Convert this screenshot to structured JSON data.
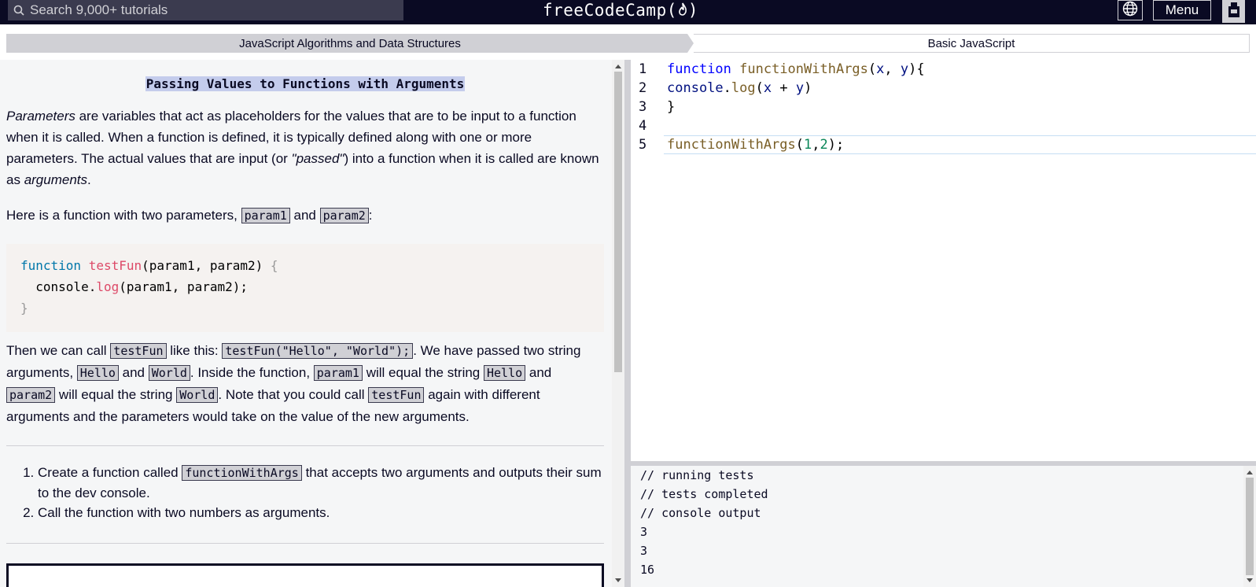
{
  "nav": {
    "search_placeholder": "Search 9,000+ tutorials",
    "brand": "freeCodeCamp(🔥)",
    "brand_text": "freeCodeCamp(",
    "brand_close": ")",
    "menu_label": "Menu",
    "globe_icon": "globe-icon",
    "avatar_icon": "avatar-icon"
  },
  "breadcrumb": {
    "superblock": "JavaScript Algorithms and Data Structures",
    "block": "Basic JavaScript"
  },
  "lesson": {
    "title": "Passing Values to Functions with Arguments",
    "p1_em1": "Parameters",
    "p1_a": " are variables that act as placeholders for the values that are to be input to a function when it is called. When a function is defined, it is typically defined along with one or more parameters. The actual values that are input (or ",
    "p1_em2": "\"passed\"",
    "p1_b": ") into a function when it is called are known as ",
    "p1_em3": "arguments",
    "p1_c": ".",
    "p2_a": "Here is a function with two parameters, ",
    "p2_code1": "param1",
    "p2_b": " and ",
    "p2_code2": "param2",
    "p2_c": ":",
    "code": {
      "l1_kw": "function",
      "l1_fn": "testFun",
      "l1_rest": "(param1, param2) ",
      "l1_brace": "{",
      "l2_a": "  console.",
      "l2_fn": "log",
      "l2_b": "(param1, param2);",
      "l3": "}"
    },
    "p3_a": "Then we can call ",
    "p3_c1": "testFun",
    "p3_b": " like this: ",
    "p3_c2": "testFun(\"Hello\", \"World\");",
    "p3_c": ". We have passed two string arguments, ",
    "p3_c3": "Hello",
    "p3_d": " and ",
    "p3_c4": "World",
    "p3_e": ". Inside the function, ",
    "p3_c5": "param1",
    "p3_f": " will equal the string ",
    "p3_c6": "Hello",
    "p3_g": " and ",
    "p3_c7": "param2",
    "p3_h": " will equal the string ",
    "p3_c8": "World",
    "p3_i": ". Note that you could call ",
    "p3_c9": "testFun",
    "p3_j": " again with different arguments and the parameters would take on the value of the new arguments.",
    "instructions": {
      "i1_a": "Create a function called ",
      "i1_code": "functionWithArgs",
      "i1_b": " that accepts two arguments and outputs their sum to the dev console.",
      "i2": "Call the function with two numbers as arguments."
    }
  },
  "editor": {
    "lines": [
      {
        "num": "1"
      },
      {
        "num": "2"
      },
      {
        "num": "3"
      },
      {
        "num": "4"
      },
      {
        "num": "5"
      }
    ],
    "l1_kw": "function",
    "l1_fn": "functionWithArgs",
    "l1_p1": "(",
    "l1_x": "x",
    "l1_comma": ", ",
    "l1_y": "y",
    "l1_p2": "){",
    "l2_a": "console",
    "l2_b": ".",
    "l2_fn": "log",
    "l2_c": "(",
    "l2_x": "x",
    "l2_op": " + ",
    "l2_y": "y",
    "l2_d": ")",
    "l3": "}",
    "l5_fn": "functionWithArgs",
    "l5_a": "(",
    "l5_n1": "1",
    "l5_comma": ",",
    "l5_n2": "2",
    "l5_b": ");"
  },
  "console": {
    "lines": [
      "// running tests",
      "// tests completed",
      "// console output",
      "3",
      "3",
      "16"
    ]
  }
}
